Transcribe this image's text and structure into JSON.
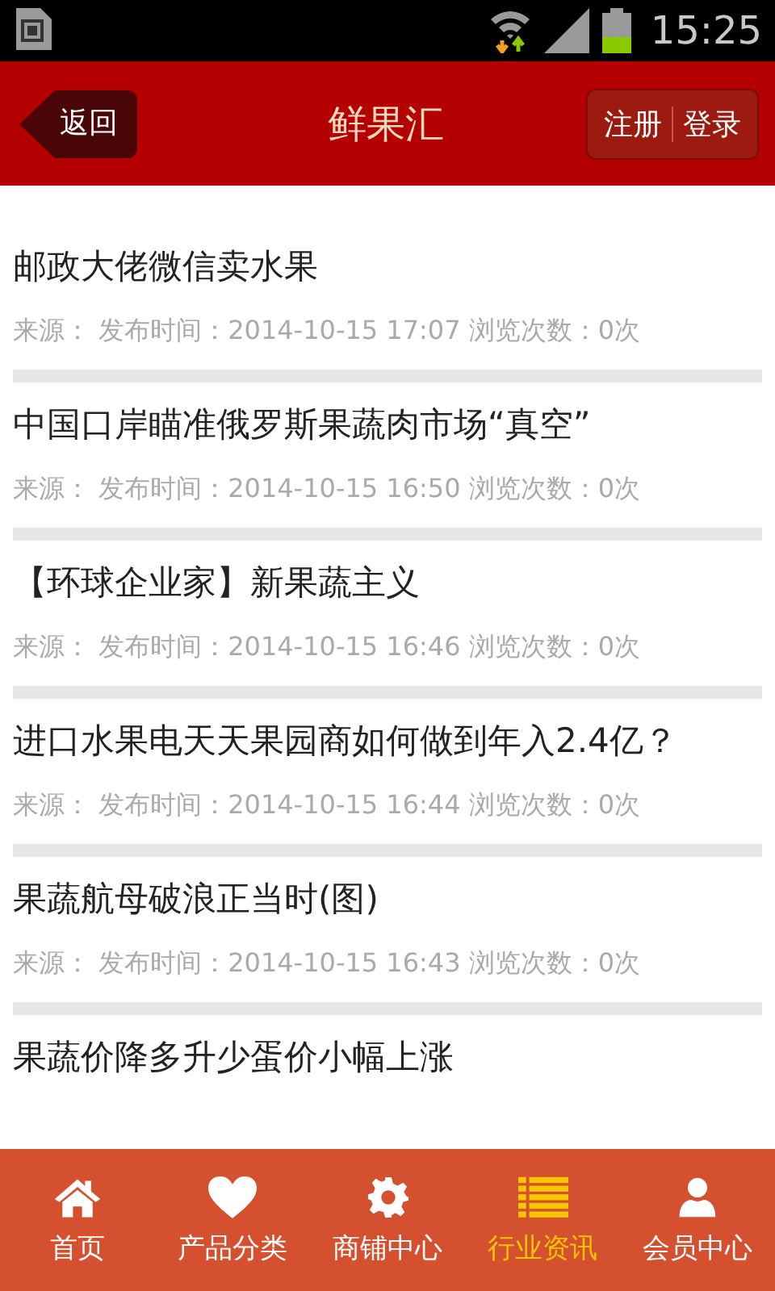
{
  "status_bar": {
    "time": "15:25"
  },
  "header": {
    "back": "返回",
    "title": "鲜果汇",
    "actions": [
      "注册",
      "登录"
    ]
  },
  "articles": [
    {
      "title": "邮政大佬微信卖水果",
      "meta": "来源： 发布时间：2014-10-15 17:07 浏览次数：0次"
    },
    {
      "title": "中国口岸瞄准俄罗斯果蔬肉市场“真空”",
      "meta": "来源： 发布时间：2014-10-15 16:50 浏览次数：0次"
    },
    {
      "title": "【环球企业家】新果蔬主义",
      "meta": "来源： 发布时间：2014-10-15 16:46 浏览次数：0次"
    },
    {
      "title": "进口水果电天天果园商如何做到年入2.4亿？",
      "meta": "来源： 发布时间：2014-10-15 16:44 浏览次数：0次"
    },
    {
      "title": "果蔬航母破浪正当时(图)",
      "meta": "来源： 发布时间：2014-10-15 16:43 浏览次数：0次"
    },
    {
      "title": "果蔬价降多升少蛋价小幅上涨"
    }
  ],
  "tab_bar": [
    {
      "kind": "home",
      "label": "首页",
      "selected": false
    },
    {
      "kind": "heart",
      "label": "产品分类",
      "selected": false
    },
    {
      "kind": "gear",
      "label": "商铺中心",
      "selected": false
    },
    {
      "kind": "list",
      "label": "行业资讯",
      "selected": true
    },
    {
      "kind": "person",
      "label": "会员中心",
      "selected": false
    }
  ]
}
